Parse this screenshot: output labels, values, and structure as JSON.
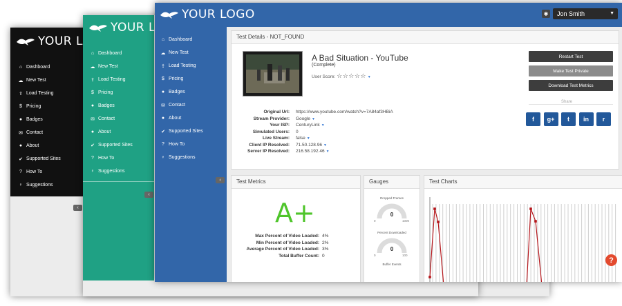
{
  "logo": "YOUR LOGO",
  "nav": [
    "Dashboard",
    "New Test",
    "Load Testing",
    "Pricing",
    "Badges",
    "Contact",
    "About",
    "Supported Sites",
    "How To",
    "Suggestions"
  ],
  "icons": [
    "home-icon",
    "cloud-icon",
    "cloud-upload-icon",
    "dollar-icon",
    "circle-icon",
    "envelope-icon",
    "info-icon",
    "check-icon",
    "question-icon",
    "lightbulb-icon"
  ],
  "user": {
    "name": "Jon Smith"
  },
  "details": {
    "header": "Test Details - NOT_FOUND",
    "title": "A Bad Situation - YouTube",
    "status": "(Complete)",
    "score_label": "User Score:",
    "rows": [
      {
        "k": "Original Url:",
        "v": "https://www.youtube.com/watch?v=7A84af3HBiA",
        "ar": false
      },
      {
        "k": "Stream Provider:",
        "v": "Google",
        "ar": true
      },
      {
        "k": "Your ISP:",
        "v": "CenturyLink",
        "ar": true
      },
      {
        "k": "Simulated Users:",
        "v": "0",
        "ar": false
      },
      {
        "k": "Live Stream:",
        "v": "false",
        "ar": true
      },
      {
        "k": "Client IP Resolved:",
        "v": "71.50.128.96",
        "ar": true
      },
      {
        "k": "Server IP Resolved:",
        "v": "216.58.192.46",
        "ar": true
      }
    ],
    "buttons": [
      "Restart Test",
      "Make Test Private",
      "Download Test Metrics"
    ],
    "share_label": "Share",
    "social": [
      "f",
      "g+",
      "t",
      "in",
      "r"
    ]
  },
  "metrics": {
    "header": "Test Metrics",
    "grade": "A+",
    "rows": [
      {
        "k": "Max Percent of Video Loaded:",
        "v": "4%"
      },
      {
        "k": "Min Percent of Video Loaded:",
        "v": "2%"
      },
      {
        "k": "Average Percent of Video Loaded:",
        "v": "3%"
      },
      {
        "k": "Total Buffer Count:",
        "v": "0"
      }
    ]
  },
  "gauges": {
    "header": "Gauges",
    "items": [
      {
        "label": "Dropped Frames",
        "value": "0",
        "min": "0",
        "max": "1000"
      },
      {
        "label": "Percent Downloaded",
        "value": "0",
        "min": "0",
        "max": "100"
      }
    ],
    "third_label": "Buffer Events"
  },
  "charts": {
    "header": "Test Charts"
  },
  "colors": {
    "black": "#111111",
    "green": "#1fa184",
    "blue": "#3266a9",
    "grade": "#4fc52b",
    "chart_line": "#b5161b"
  }
}
